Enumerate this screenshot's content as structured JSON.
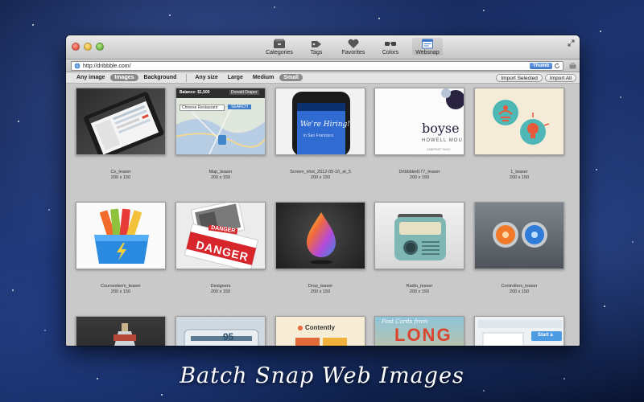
{
  "window": {
    "toolbar": [
      {
        "label": "Categories",
        "icon": "categories-icon",
        "active": false
      },
      {
        "label": "Tags",
        "icon": "tags-icon",
        "active": false
      },
      {
        "label": "Favorites",
        "icon": "heart-icon",
        "active": false
      },
      {
        "label": "Colors",
        "icon": "glasses-icon",
        "active": false
      },
      {
        "label": "Websnap",
        "icon": "websnap-icon",
        "active": true
      }
    ],
    "url": "http://dribbble.com/",
    "thumbs_label": "Thumb",
    "filters": {
      "type": [
        "Any image",
        "Images",
        "Background"
      ],
      "type_selected": "Images",
      "size": [
        "Any size",
        "Large",
        "Medium",
        "Small"
      ],
      "size_selected": "Small"
    },
    "actions": {
      "import_selected": "Import Selected",
      "import_all": "Import All"
    }
  },
  "thumb_text": {
    "balance": "Balance: $1,500",
    "donald": "Donald Draper",
    "chinese": "Chinese Restaurant",
    "search": "SEARCH",
    "hiring": "We're Hiring!",
    "sf": "in San Francisco",
    "brand_big": "boyse",
    "brand_small": "HOWELL MOU",
    "brand_tiny": "CABERNET SAUV",
    "danger_top": "DANGER",
    "danger_main": "DANGER",
    "number": "95",
    "contently": "Contently",
    "cards_script": "Post Cards from",
    "cards_big": "LONG",
    "start": "Start a"
  },
  "images": [
    {
      "name": "Cs_teaser",
      "size": "200 x 150"
    },
    {
      "name": "Map_teaser",
      "size": "200 x 150"
    },
    {
      "name": "Screen_shot_2012-05-10_at_5",
      "size": "200 x 150"
    },
    {
      "name": "Dribbbled177_teaser",
      "size": "200 x 150"
    },
    {
      "name": "1_teaser",
      "size": "200 x 150"
    },
    {
      "name": "Coursesterm_teaser",
      "size": "200 x 150"
    },
    {
      "name": "Designers",
      "size": "200 x 150"
    },
    {
      "name": "Drop_teaser",
      "size": "200 x 150"
    },
    {
      "name": "Radio_teaser",
      "size": "200 x 150"
    },
    {
      "name": "Controllers_teaser",
      "size": "200 x 150"
    }
  ],
  "tagline": "Batch Snap Web Images",
  "colors": {
    "accent": "#3f77c9",
    "danger": "#d6262c",
    "hiring": "#2f6bd0"
  }
}
